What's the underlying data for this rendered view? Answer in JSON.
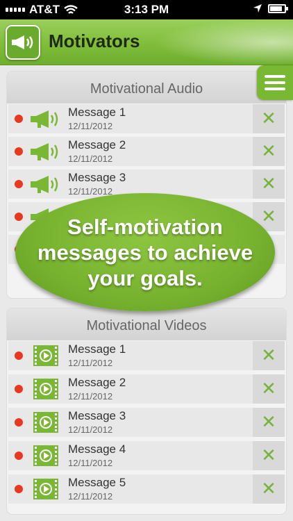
{
  "status_bar": {
    "carrier": "AT&T",
    "time": "3:13 PM"
  },
  "header": {
    "title": "Motivators"
  },
  "audio": {
    "heading": "Motivational Audio",
    "items": [
      {
        "name": "Message 1",
        "date": "12/11/2012"
      },
      {
        "name": "Message 2",
        "date": "12/11/2012"
      },
      {
        "name": "Message 3",
        "date": "12/11/2012"
      }
    ]
  },
  "video": {
    "heading": "Motivational Videos",
    "items": [
      {
        "name": "Message 1",
        "date": "12/11/2012"
      },
      {
        "name": "Message 2",
        "date": "12/11/2012"
      },
      {
        "name": "Message 3",
        "date": "12/11/2012"
      },
      {
        "name": "Message 4",
        "date": "12/11/2012"
      },
      {
        "name": "Message 5",
        "date": "12/11/2012"
      }
    ]
  },
  "promo": {
    "text": "Self-motivation messages to achieve your goals."
  },
  "icons": {
    "delete": "✕",
    "audio_item": "megaphone-icon",
    "video_item": "video-play-icon",
    "menu": "hamburger-icon"
  },
  "colors": {
    "accent": "#77b22f",
    "status_dot": "#e8391e",
    "delete_x": "#76b23c"
  }
}
